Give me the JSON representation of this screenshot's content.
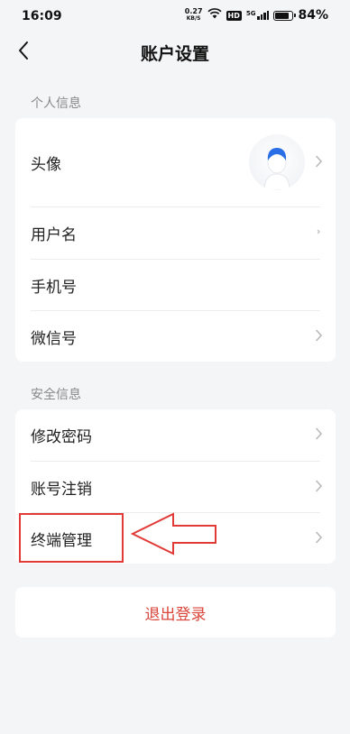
{
  "status_bar": {
    "time": "16:09",
    "net_speed_value": "0.27",
    "net_speed_unit": "KB/S",
    "hd_label": "HD",
    "network_label": "5G",
    "battery_percent": "84%",
    "battery_level": 0.84
  },
  "header": {
    "title": "账户设置",
    "back_icon": "chevron-left-icon"
  },
  "personal_section": {
    "label": "个人信息",
    "items": [
      {
        "label": "头像",
        "type": "avatar",
        "icon": "default-avatar-icon"
      },
      {
        "label": "用户名"
      },
      {
        "label": "手机号"
      },
      {
        "label": "微信号"
      }
    ]
  },
  "security_section": {
    "label": "安全信息",
    "items": [
      {
        "label": "修改密码"
      },
      {
        "label": "账号注销"
      },
      {
        "label": "终端管理"
      }
    ]
  },
  "logout": {
    "label": "退出登录",
    "color": "#d9453a"
  },
  "annotation": {
    "color": "#e23a36",
    "target": "终端管理",
    "shape": "left-pointing-arrow"
  }
}
